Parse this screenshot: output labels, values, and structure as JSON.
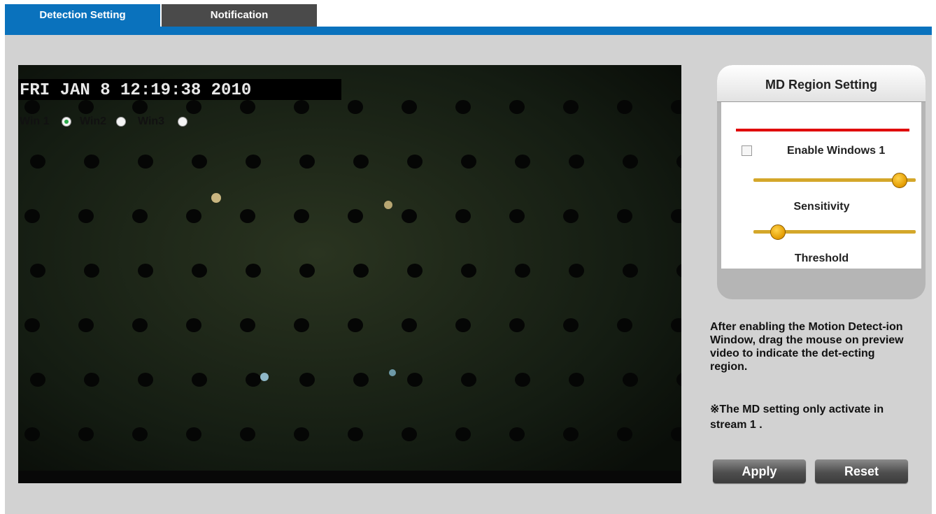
{
  "tabs": [
    {
      "label": "Detection Setting",
      "active": true
    },
    {
      "label": "Notification",
      "active": false
    }
  ],
  "video": {
    "osd_text": "FRI JAN  8 12:19:38 2010"
  },
  "md_panel": {
    "title": "MD Region Setting",
    "windows": [
      {
        "label": "Win 1",
        "selected": true
      },
      {
        "label": "Win2",
        "selected": false
      },
      {
        "label": "Win3",
        "selected": false
      }
    ],
    "enable_label": "Enable Windows 1",
    "enable_checked": false,
    "sensitivity_label": "Sensitivity",
    "sensitivity_value": 0.9,
    "threshold_label": "Threshold",
    "threshold_value": 0.15
  },
  "help_text": "After enabling the Motion Detect-ion Window, drag the mouse on preview video to indicate the det-ecting region.",
  "note_text": "※The MD setting only activate in stream 1 .",
  "buttons": {
    "apply": "Apply",
    "reset": "Reset"
  },
  "colors": {
    "tab_active": "#0a72bd",
    "tab_inactive": "#4a4a4a",
    "highlight_underline": "#e00000",
    "slider": "#d4a72a"
  }
}
